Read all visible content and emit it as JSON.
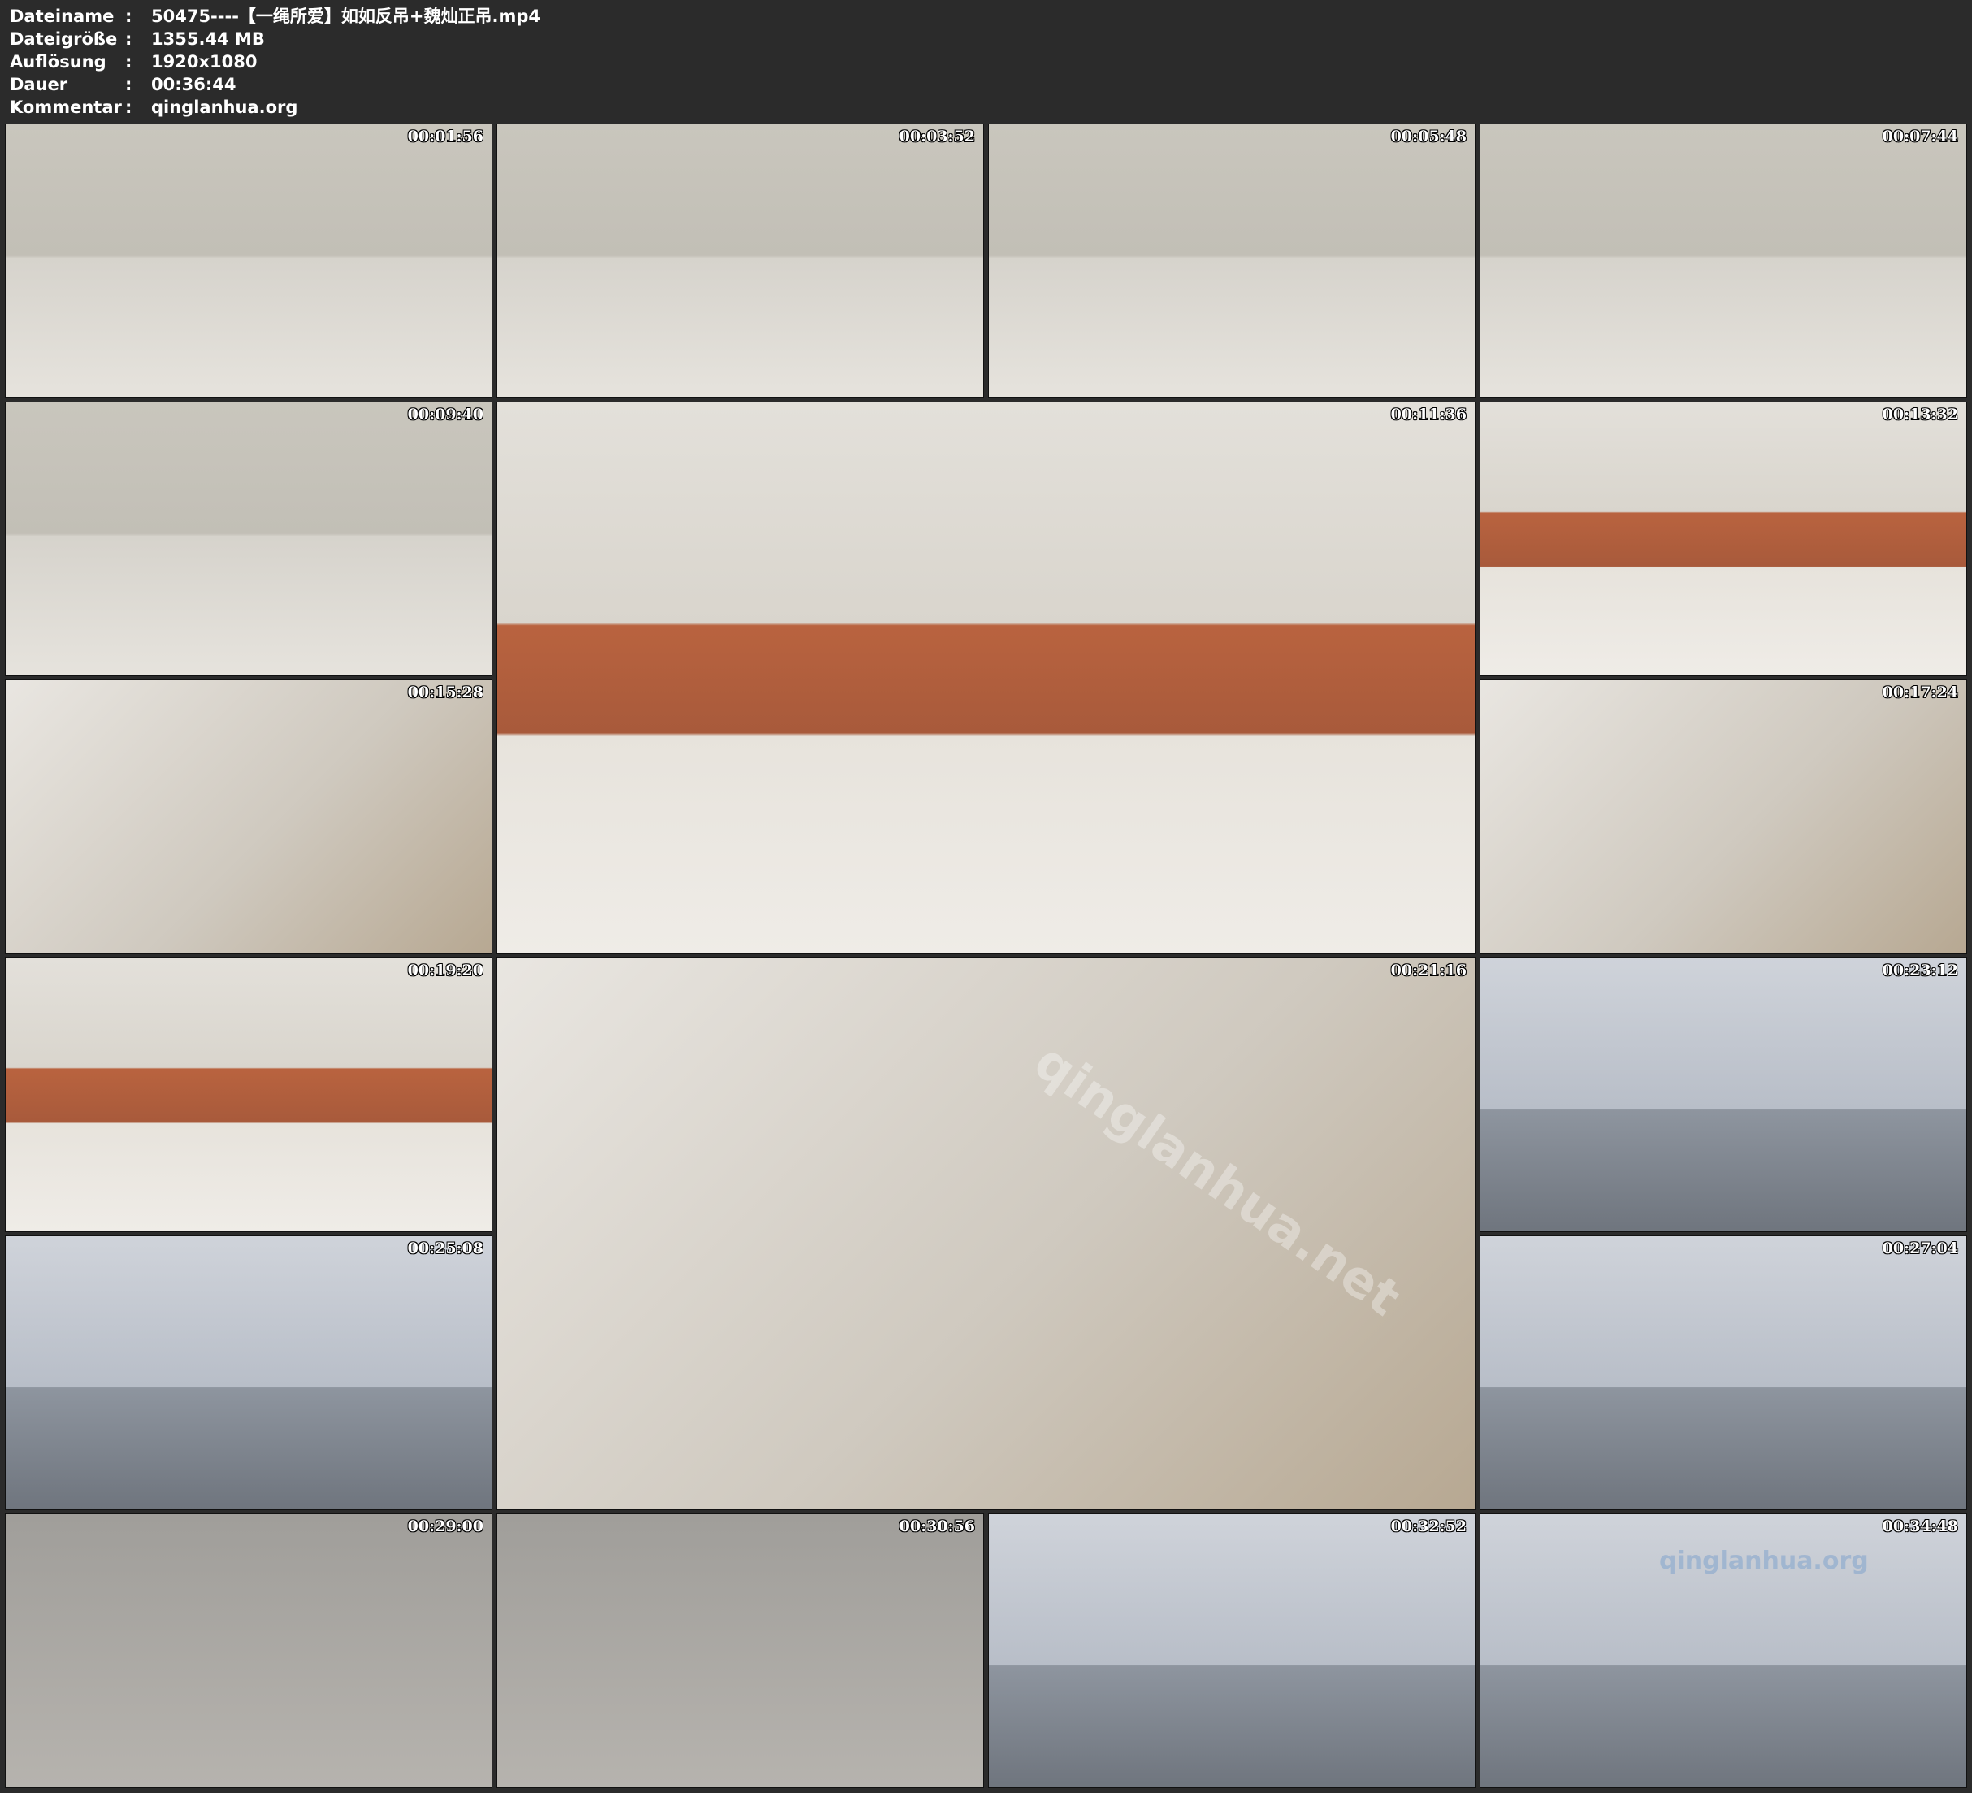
{
  "meta": [
    {
      "key": "Dateiname",
      "value": "50475----【一绳所爱】如如反吊+魏灿正吊.mp4"
    },
    {
      "key": "Dateigröße",
      "value": "1355.44 MB"
    },
    {
      "key": "Auflösung",
      "value": "1920x1080"
    },
    {
      "key": "Dauer",
      "value": "00:36:44"
    },
    {
      "key": "Kommentar",
      "value": "qinglanhua.org"
    }
  ],
  "separator": ":",
  "frames": [
    {
      "id": "f1",
      "time": "00:01:56",
      "scene": "room"
    },
    {
      "id": "f2",
      "time": "00:03:52",
      "scene": "room"
    },
    {
      "id": "f3",
      "time": "00:05:48",
      "scene": "room"
    },
    {
      "id": "f4",
      "time": "00:07:44",
      "scene": "room"
    },
    {
      "id": "f5",
      "time": "00:09:40",
      "scene": "room"
    },
    {
      "id": "f6",
      "time": "00:11:36",
      "scene": "hall"
    },
    {
      "id": "f7",
      "time": "00:13:32",
      "scene": "hall"
    },
    {
      "id": "f8",
      "time": "00:15:28",
      "scene": "closeup"
    },
    {
      "id": "f9",
      "time": "00:17:24",
      "scene": "closeup"
    },
    {
      "id": "f10",
      "time": "00:19:20",
      "scene": "hall"
    },
    {
      "id": "f11",
      "time": "00:21:16",
      "scene": "closeup"
    },
    {
      "id": "f12",
      "time": "00:23:12",
      "scene": "studio"
    },
    {
      "id": "f13",
      "time": "00:25:08",
      "scene": "studio"
    },
    {
      "id": "f14",
      "time": "00:27:04",
      "scene": "studio"
    },
    {
      "id": "f15",
      "time": "00:29:00",
      "scene": "floor"
    },
    {
      "id": "f16",
      "time": "00:30:56",
      "scene": "floor"
    },
    {
      "id": "f17",
      "time": "00:32:52",
      "scene": "studio"
    },
    {
      "id": "f18",
      "time": "00:34:48",
      "scene": "studio"
    }
  ],
  "watermark": {
    "large": "qinglanhua.net",
    "small": "qinglanhua.org"
  }
}
